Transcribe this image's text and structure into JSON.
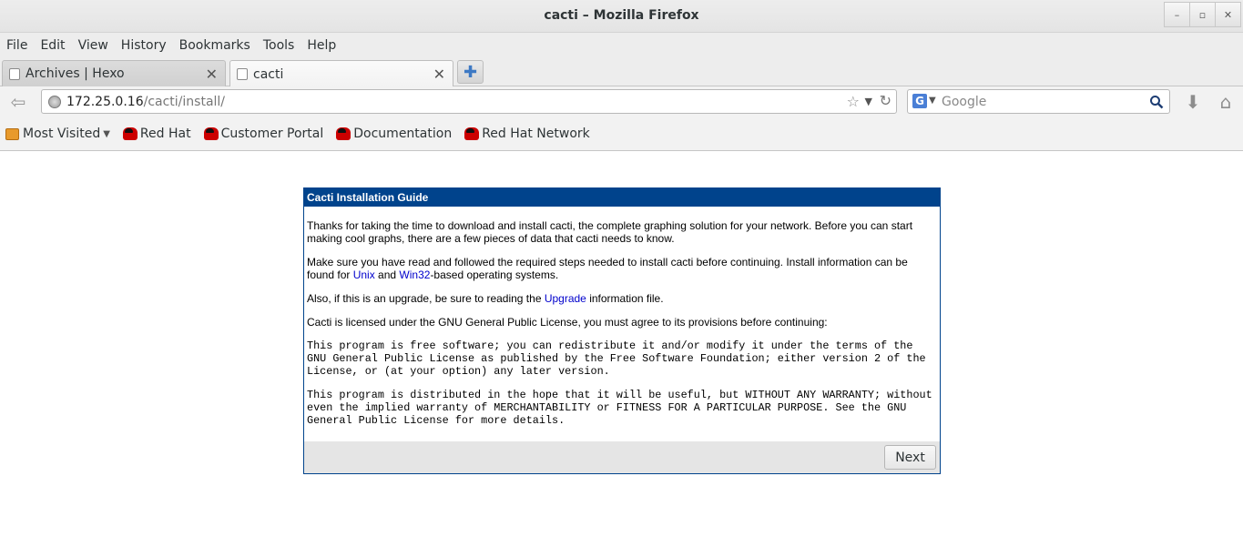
{
  "window": {
    "title": "cacti – Mozilla Firefox",
    "buttons": {
      "minimize": "–",
      "maximize": "▫",
      "close": "✕"
    }
  },
  "menu": {
    "items": [
      "File",
      "Edit",
      "View",
      "History",
      "Bookmarks",
      "Tools",
      "Help"
    ]
  },
  "tabs": [
    {
      "label": "Archives | Hexo",
      "active": false
    },
    {
      "label": "cacti",
      "active": true
    }
  ],
  "navigation": {
    "url_host": "172.25.0.16",
    "url_path": "/cacti/install/",
    "search_placeholder": "Google",
    "search_engine_icon": "G"
  },
  "bookmarks": {
    "most_visited": "Most Visited",
    "items": [
      "Red Hat",
      "Customer Portal",
      "Documentation",
      "Red Hat Network"
    ]
  },
  "install": {
    "header": "Cacti Installation Guide",
    "p1": "Thanks for taking the time to download and install cacti, the complete graphing solution for your network. Before you can start making cool graphs, there are a few pieces of data that cacti needs to know.",
    "p2_pre": "Make sure you have read and followed the required steps needed to install cacti before continuing. Install information can be found for ",
    "p2_link1": "Unix",
    "p2_mid": " and ",
    "p2_link2": "Win32",
    "p2_post": "-based operating systems.",
    "p3_pre": "Also, if this is an upgrade, be sure to reading the ",
    "p3_link": "Upgrade",
    "p3_post": " information file.",
    "p4": "Cacti is licensed under the GNU General Public License, you must agree to its provisions before continuing:",
    "license1": "This program is free software; you can redistribute it and/or modify it under the terms of the GNU General Public License as published by the Free Software Foundation; either version 2 of the License, or (at your option) any later version.",
    "license2": "This program is distributed in the hope that it will be useful, but WITHOUT ANY WARRANTY; without even the implied warranty of MERCHANTABILITY or FITNESS FOR A PARTICULAR PURPOSE. See the GNU General Public License for more details.",
    "next_label": "Next"
  },
  "colors": {
    "panel_header": "#00438c",
    "link": "#0000cc",
    "footer": "#e5e5e5"
  }
}
